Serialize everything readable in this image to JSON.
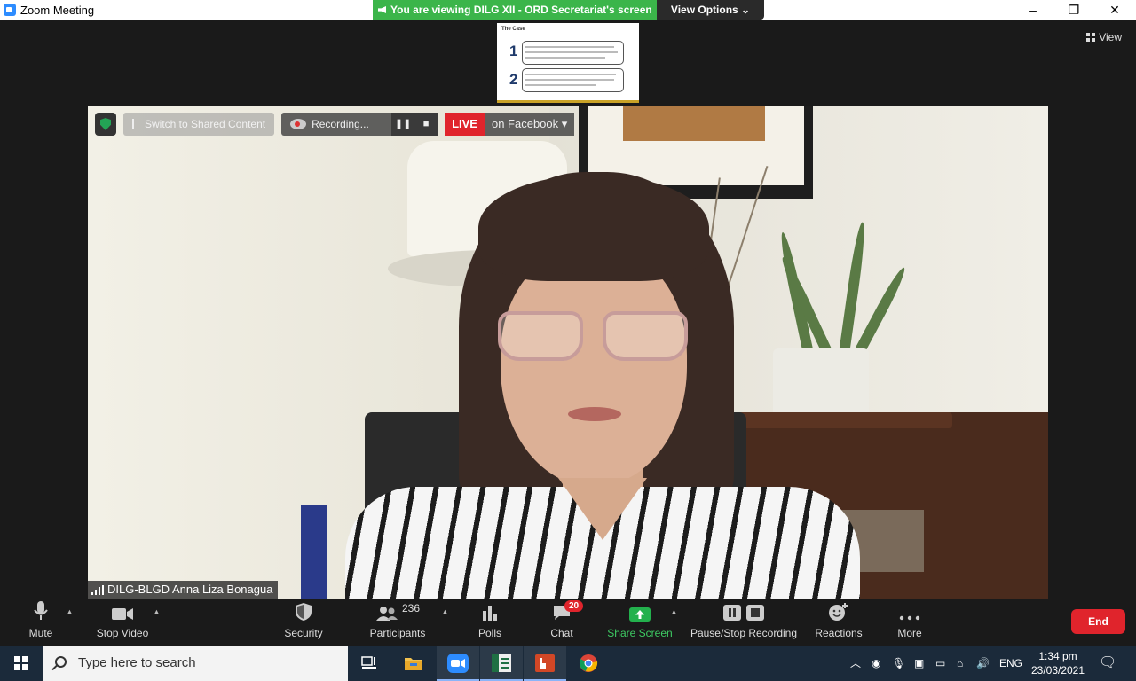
{
  "window": {
    "title": "Zoom Meeting",
    "minimize": "–",
    "restore": "❐",
    "close": "✕"
  },
  "banner": {
    "viewing_text": "You are viewing DILG XII - ORD Secretariat's screen",
    "view_options": "View Options ⌄"
  },
  "shared_thumb": {
    "title": "The Case",
    "items": [
      "1",
      "2"
    ]
  },
  "view_button": "View",
  "overlay": {
    "switch_label": "Switch to Shared Content",
    "recording_label": "Recording...",
    "pause_glyph": "❚❚",
    "stop_glyph": "■",
    "live_label": "LIVE",
    "live_on": "on Facebook ▾"
  },
  "name_tag": "DILG-BLGD Anna Liza Bonagua",
  "toolbar": {
    "mute": "Mute",
    "stop_video": "Stop Video",
    "security": "Security",
    "participants": "Participants",
    "participants_count": "236",
    "polls": "Polls",
    "chat": "Chat",
    "chat_badge": "20",
    "share_screen": "Share Screen",
    "pause_stop_recording": "Pause/Stop Recording",
    "reactions": "Reactions",
    "more": "More",
    "end": "End"
  },
  "taskbar": {
    "search_placeholder": "Type here to search",
    "language": "ENG",
    "time": "1:34 pm",
    "date": "23/03/2021"
  },
  "colors": {
    "accent_green": "#3bb54a",
    "live_red": "#e0242c",
    "zoom_blue": "#2d8cff"
  }
}
